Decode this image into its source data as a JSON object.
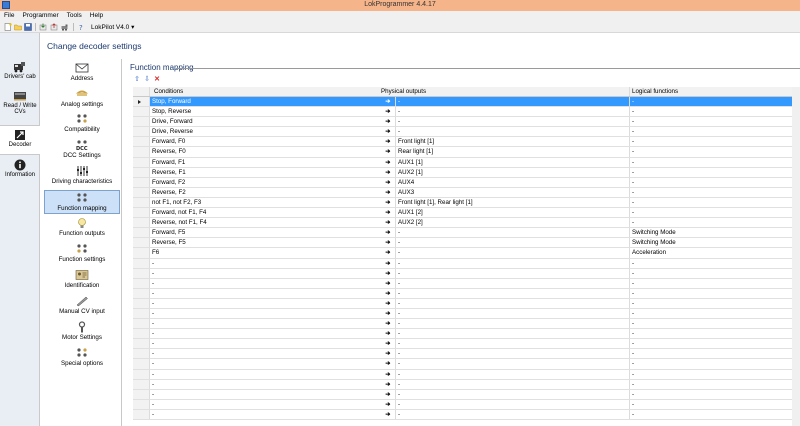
{
  "window": {
    "title": "LokProgrammer 4.4.17"
  },
  "menu": [
    "File",
    "Programmer",
    "Tools",
    "Help"
  ],
  "toolbar": {
    "decoder": "LokPilot V4.0 ▾"
  },
  "nav": [
    {
      "label": "Drivers' cab",
      "icon": "train-icon"
    },
    {
      "label": "Read / Write CVs",
      "icon": "decoder-chip-icon"
    },
    {
      "label": "Decoder",
      "icon": "chip-arrow-icon"
    },
    {
      "label": "Information",
      "icon": "info-icon"
    }
  ],
  "page_title": "Change decoder settings",
  "categories": [
    {
      "label": "Address",
      "icon": "envelope-icon"
    },
    {
      "label": "Analog settings",
      "icon": "dc-plug-icon"
    },
    {
      "label": "Compatibility",
      "icon": "puzzle-icon"
    },
    {
      "label": "DCC Settings",
      "icon": "dcc-icon"
    },
    {
      "label": "Driving characteristics",
      "icon": "sliders-icon"
    },
    {
      "label": "Function mapping",
      "icon": "grid-icon"
    },
    {
      "label": "Function outputs",
      "icon": "lightbulb-icon"
    },
    {
      "label": "Function settings",
      "icon": "function-grid-icon"
    },
    {
      "label": "Identification",
      "icon": "id-card-icon"
    },
    {
      "label": "Manual CV input",
      "icon": "pen-icon"
    },
    {
      "label": "Motor Settings",
      "icon": "wrench-icon"
    },
    {
      "label": "Special options",
      "icon": "options-icon"
    }
  ],
  "section_title": "Function mapping",
  "grid": {
    "columns": [
      "Conditions",
      "Physical outputs",
      "Logical functions"
    ],
    "rows": [
      [
        "Stop, Forward",
        "-",
        "-"
      ],
      [
        "Stop, Reverse",
        "-",
        "-"
      ],
      [
        "Drive, Forward",
        "-",
        "-"
      ],
      [
        "Drive, Reverse",
        "-",
        "-"
      ],
      [
        "Forward, F0",
        "Front light [1]",
        "-"
      ],
      [
        "Reverse, F0",
        "Rear light [1]",
        "-"
      ],
      [
        "Forward, F1",
        "AUX1 [1]",
        "-"
      ],
      [
        "Reverse, F1",
        "AUX2 [1]",
        "-"
      ],
      [
        "Forward, F2",
        "AUX4",
        "-"
      ],
      [
        "Reverse, F2",
        "AUX3",
        "-"
      ],
      [
        "not F1, not F2, F3",
        "Front light [1], Rear light [1]",
        "-"
      ],
      [
        "Forward, not F1, F4",
        "AUX1 [2]",
        "-"
      ],
      [
        "Reverse, not F1, F4",
        "AUX2 [2]",
        "-"
      ],
      [
        "Forward, F5",
        "-",
        "Switching Mode"
      ],
      [
        "Reverse, F5",
        "-",
        "Switching Mode"
      ],
      [
        "F6",
        "-",
        "Acceleration"
      ],
      [
        "-",
        "-",
        "-"
      ],
      [
        "-",
        "-",
        "-"
      ],
      [
        "-",
        "-",
        "-"
      ],
      [
        "-",
        "-",
        "-"
      ],
      [
        "-",
        "-",
        "-"
      ],
      [
        "-",
        "-",
        "-"
      ],
      [
        "-",
        "-",
        "-"
      ],
      [
        "-",
        "-",
        "-"
      ],
      [
        "-",
        "-",
        "-"
      ],
      [
        "-",
        "-",
        "-"
      ],
      [
        "-",
        "-",
        "-"
      ],
      [
        "-",
        "-",
        "-"
      ],
      [
        "-",
        "-",
        "-"
      ],
      [
        "-",
        "-",
        "-"
      ],
      [
        "-",
        "-",
        "-"
      ],
      [
        "-",
        "-",
        "-"
      ]
    ]
  }
}
